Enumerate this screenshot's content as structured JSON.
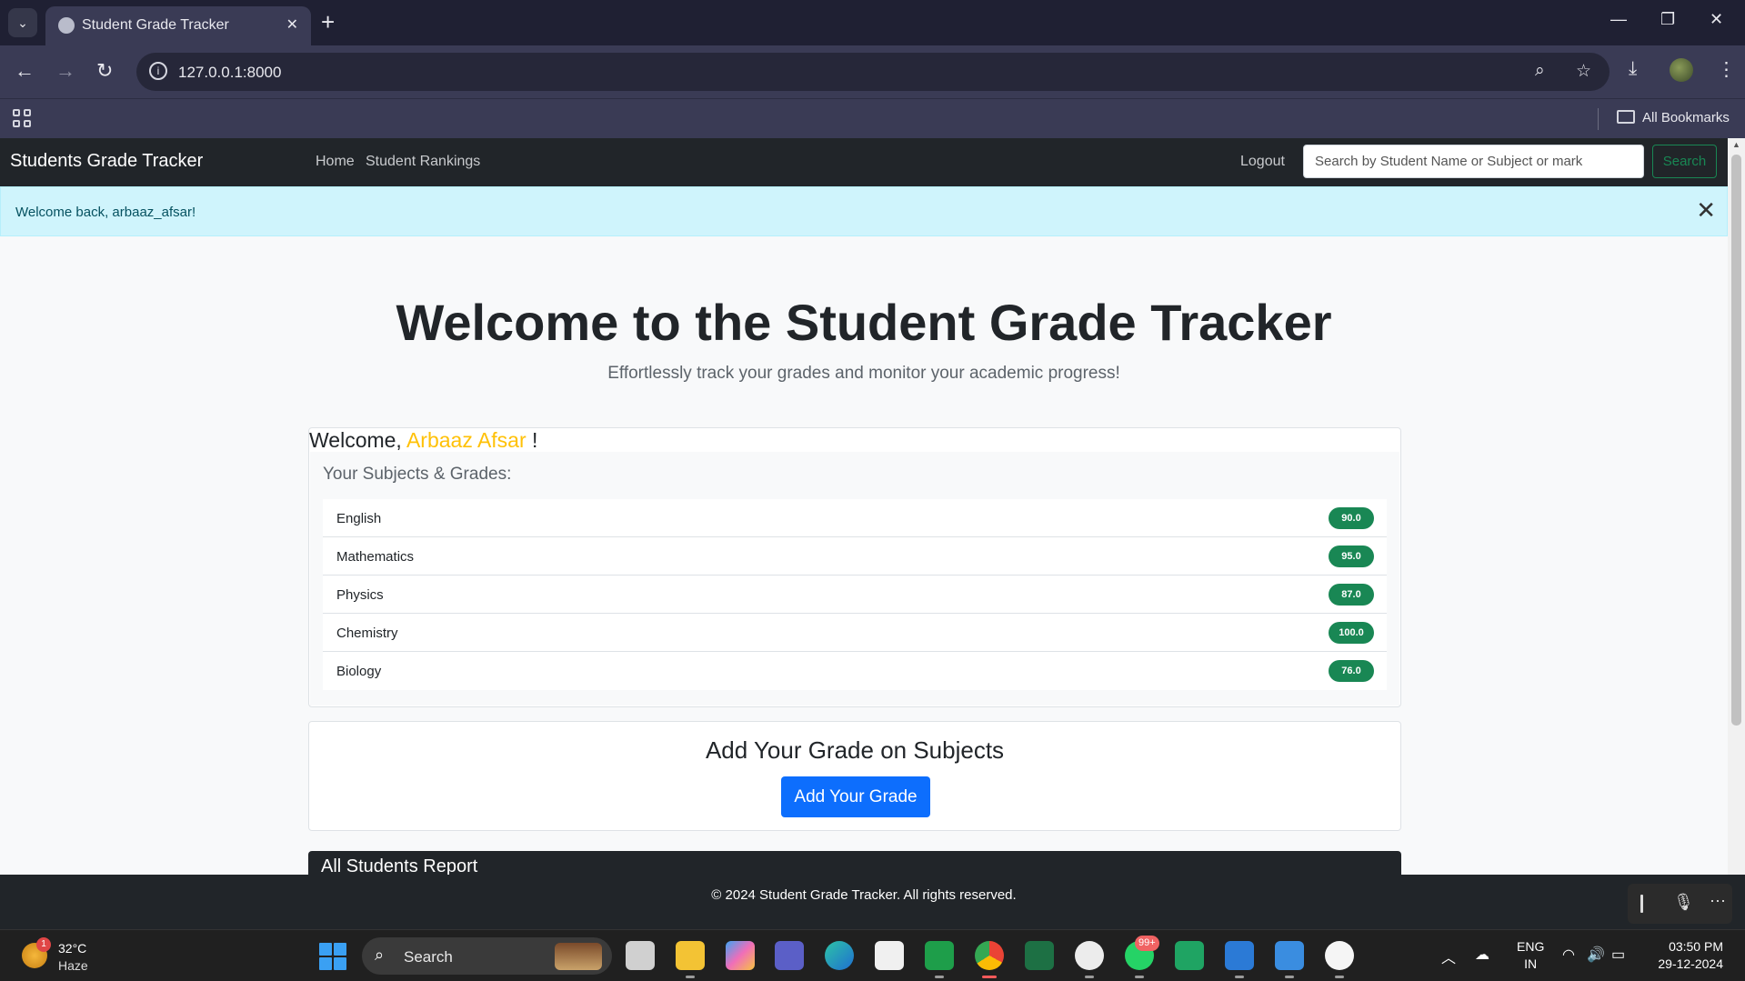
{
  "browser": {
    "tab_title": "Student Grade Tracker",
    "url": "127.0.0.1:8000",
    "bookmarks_label": "All Bookmarks"
  },
  "app": {
    "brand": "Students Grade Tracker",
    "nav": [
      {
        "label": "Home"
      },
      {
        "label": "Student Rankings"
      }
    ],
    "logout_label": "Logout",
    "search_placeholder": "Search by Student Name or Subject or mark",
    "search_button": "Search"
  },
  "alert": {
    "message": "Welcome back, arbaaz_afsar!"
  },
  "hero": {
    "title": "Welcome to the Student Grade Tracker",
    "subtitle": "Effortlessly track your grades and monitor your academic progress!"
  },
  "grades_card": {
    "welcome_prefix": "Welcome,",
    "student_name": "Arbaaz Afsar",
    "welcome_suffix": "!",
    "heading": "Your Subjects & Grades:",
    "subjects": [
      {
        "name": "English",
        "grade": "90.0"
      },
      {
        "name": "Mathematics",
        "grade": "95.0"
      },
      {
        "name": "Physics",
        "grade": "87.0"
      },
      {
        "name": "Chemistry",
        "grade": "100.0"
      },
      {
        "name": "Biology",
        "grade": "76.0"
      }
    ]
  },
  "add_card": {
    "title": "Add Your Grade on Subjects",
    "button": "Add Your Grade"
  },
  "next_section": {
    "title_partial": "All Students Report"
  },
  "footer": {
    "text": "© 2024 Student Grade Tracker. All rights reserved."
  },
  "taskbar": {
    "weather_temp": "32°C",
    "weather_condition": "Haze",
    "weather_badge": "1",
    "search_label": "Search",
    "whatsapp_badge": "99+",
    "lang_line1": "ENG",
    "lang_line2": "IN",
    "time": "03:50 PM",
    "date": "29-12-2024"
  },
  "colors": {
    "navbar": "#212529",
    "alert_bg": "#cff4fc",
    "student_name": "#ffc107",
    "grade_badge": "#198754",
    "primary_button": "#0d6efd"
  }
}
